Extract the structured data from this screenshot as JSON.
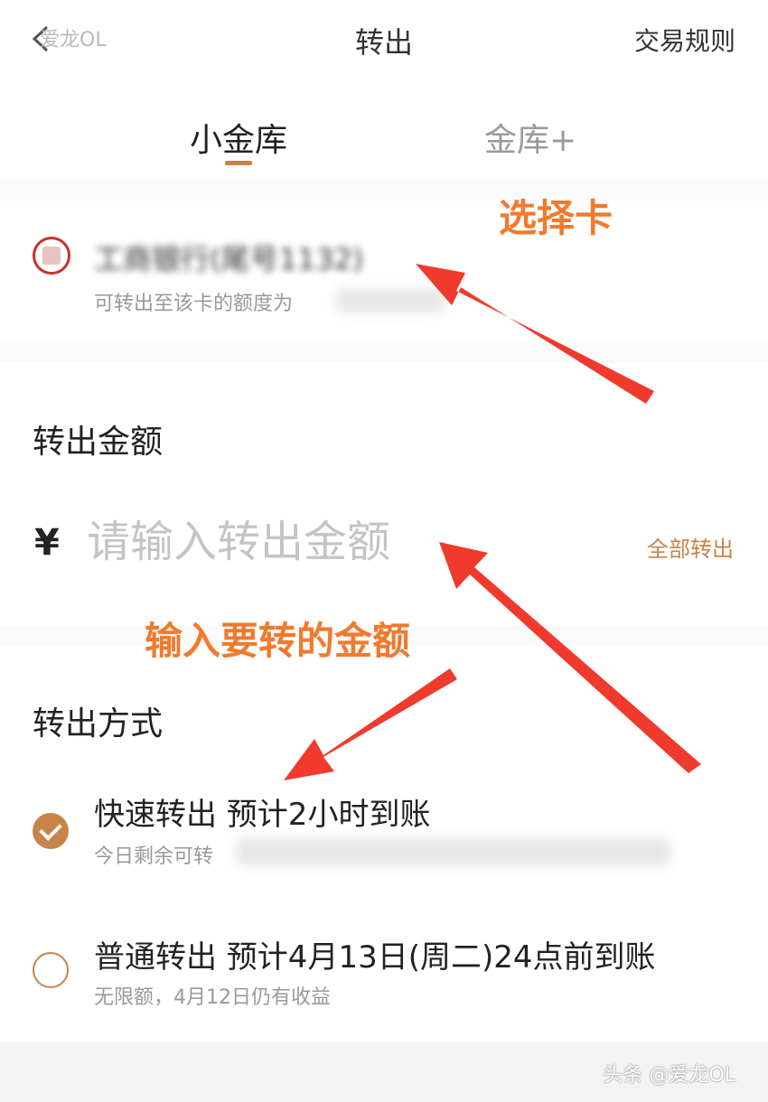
{
  "header": {
    "watermark": "爱龙OL",
    "title": "转出",
    "rules_label": "交易规则"
  },
  "tabs": [
    {
      "label": "小金库",
      "active": true
    },
    {
      "label": "金库+",
      "active": false
    }
  ],
  "card": {
    "bank_name": "工商银行(尾号1132)",
    "limit_text": "可转出至该卡的额度为"
  },
  "amount": {
    "label": "转出金额",
    "currency_symbol": "¥",
    "placeholder": "请输入转出金额",
    "all_out_label": "全部转出"
  },
  "method": {
    "label": "转出方式",
    "options": [
      {
        "title": "快速转出 预计2小时到账",
        "subtitle": "今日剩余可转",
        "checked": true
      },
      {
        "title": "普通转出 预计4月13日(周二)24点前到账",
        "subtitle": "无限额，4月12日仍有收益",
        "checked": false
      }
    ]
  },
  "annotations": {
    "select_card": "选择卡",
    "input_amount": "输入要转的金额"
  },
  "footer": {
    "watermark": "头条 @爱龙OL"
  },
  "colors": {
    "accent": "#c8834b",
    "annotation": "#f17a2c",
    "arrow": "#f03a2e"
  }
}
